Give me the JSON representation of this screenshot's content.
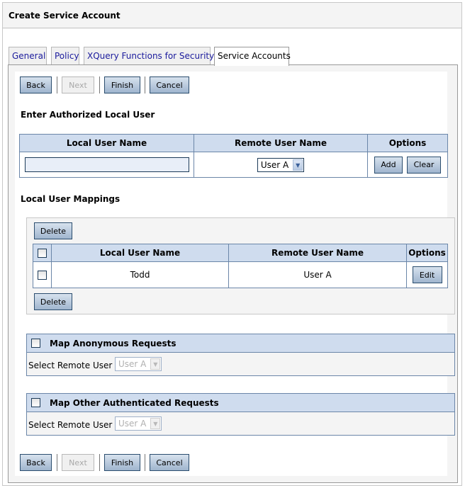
{
  "window": {
    "title": "Create Service Account"
  },
  "tabs": [
    {
      "label": "General",
      "active": false
    },
    {
      "label": "Policy",
      "active": false
    },
    {
      "label": "XQuery Functions for Security",
      "active": false
    },
    {
      "label": "Service Accounts",
      "active": true
    }
  ],
  "wizard_buttons": {
    "back": "Back",
    "next": "Next",
    "finish": "Finish",
    "cancel": "Cancel",
    "next_disabled": true
  },
  "authorized_user": {
    "heading": "Enter Authorized Local User",
    "columns": [
      "Local User Name",
      "Remote User Name",
      "Options"
    ],
    "local_user_value": "",
    "remote_user_selected": "User A",
    "add_label": "Add",
    "clear_label": "Clear"
  },
  "mappings": {
    "heading": "Local User Mappings",
    "delete_label": "Delete",
    "columns": [
      "Local User Name",
      "Remote User Name",
      "Options"
    ],
    "rows": [
      {
        "local": "Todd",
        "remote": "User A",
        "action": "Edit",
        "checked": false
      }
    ]
  },
  "anonymous": {
    "label": "Map Anonymous Requests",
    "checked": false,
    "select_label": "Select Remote User :",
    "selected": "User A",
    "disabled": true
  },
  "other_authenticated": {
    "label": "Map Other Authenticated Requests",
    "checked": false,
    "select_label": "Select Remote User :",
    "selected": "User A",
    "disabled": true
  },
  "icons": {
    "dropdown": "chevron-down-icon",
    "checkbox": "checkbox-icon"
  },
  "colors": {
    "header_bg": "#cfdcee",
    "grid_border": "#6b86a8",
    "button_top": "#d7e2ee",
    "button_bottom": "#9fb5ce",
    "tab_link": "#1a1a9c"
  }
}
